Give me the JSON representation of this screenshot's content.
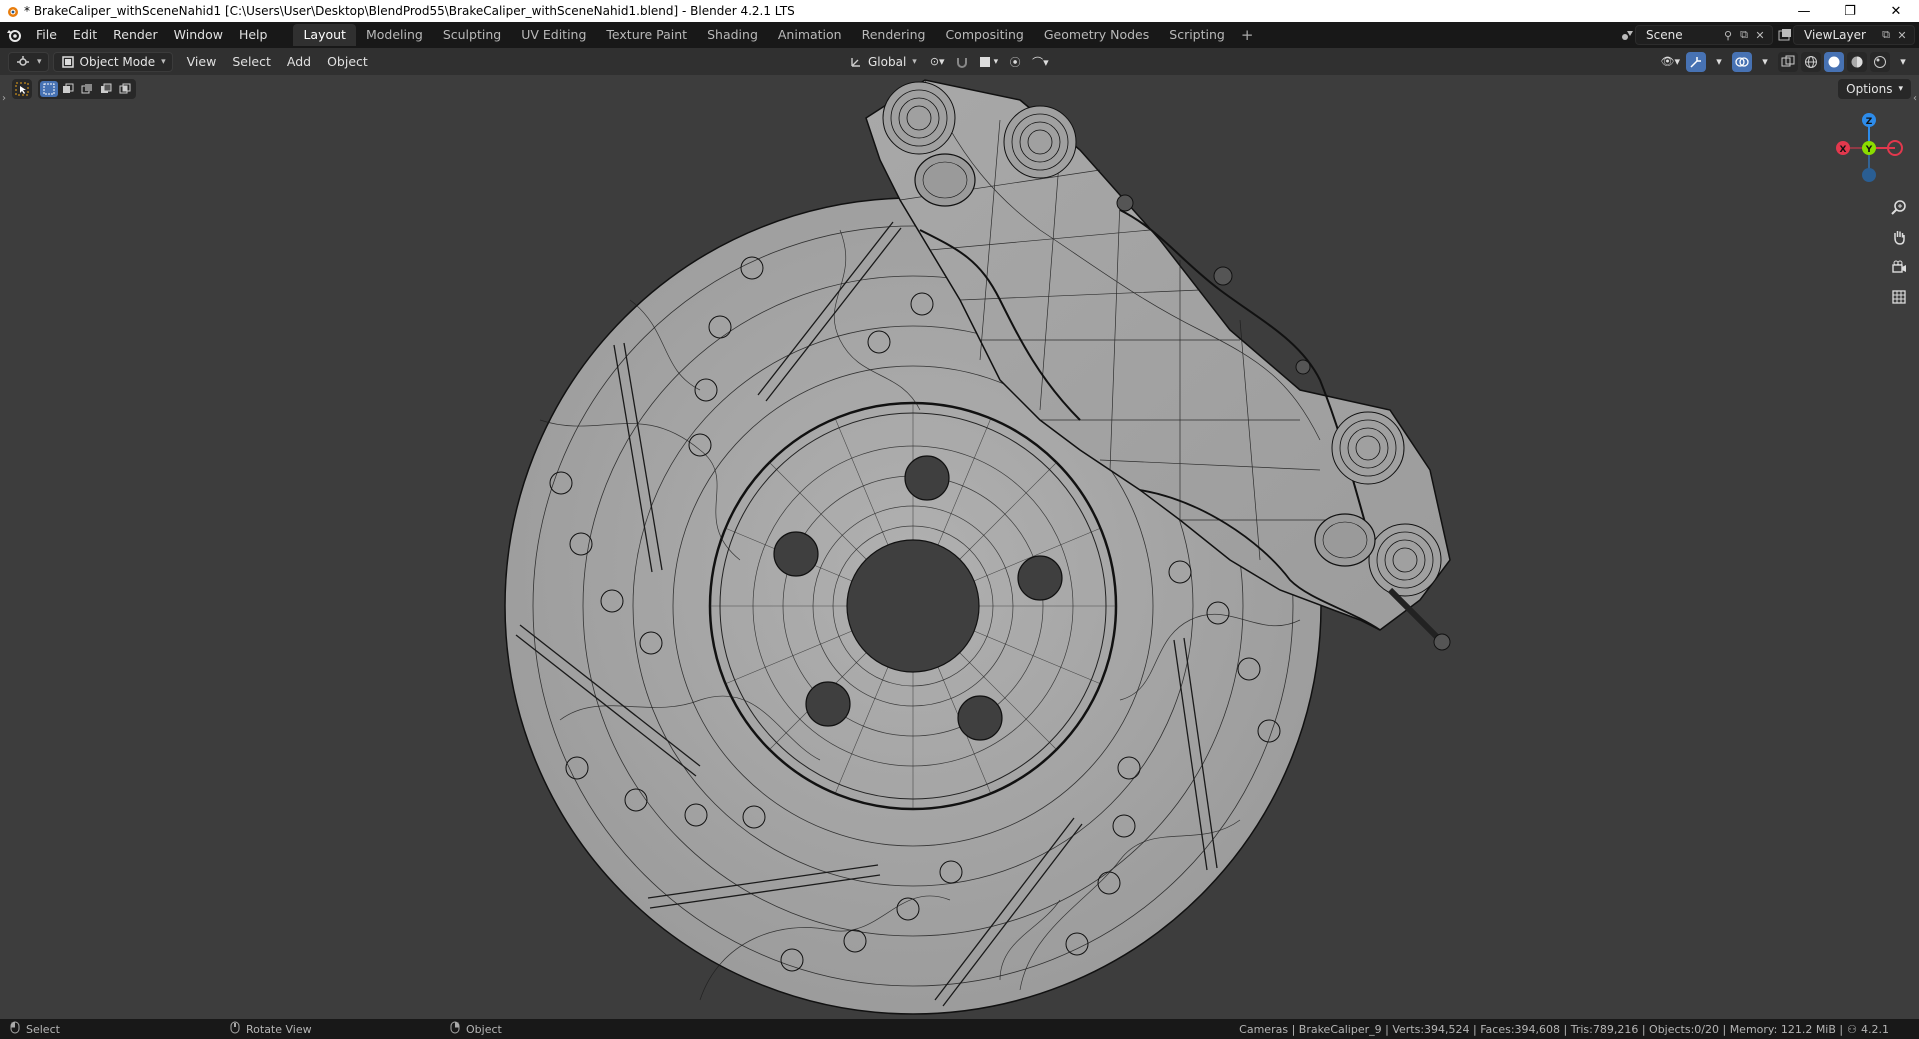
{
  "window": {
    "title": "* BrakeCaliper_withSceneNahid1 [C:\\Users\\User\\Desktop\\BlendProd55\\BrakeCaliper_withSceneNahid1.blend] - Blender 4.2.1 LTS",
    "minimize": "—",
    "maximize": "❐",
    "close": "✕"
  },
  "menu": {
    "items": [
      "File",
      "Edit",
      "Render",
      "Window",
      "Help"
    ]
  },
  "workspaces": {
    "tabs": [
      "Layout",
      "Modeling",
      "Sculpting",
      "UV Editing",
      "Texture Paint",
      "Shading",
      "Animation",
      "Rendering",
      "Compositing",
      "Geometry Nodes",
      "Scripting"
    ],
    "active": "Layout",
    "add": "+"
  },
  "scene": {
    "name": "Scene",
    "view_layer": "ViewLayer"
  },
  "header": {
    "mode": "Object Mode",
    "menus": [
      "View",
      "Select",
      "Add",
      "Object"
    ],
    "orientation": "Global"
  },
  "viewport": {
    "options_label": "Options",
    "gizmo": {
      "z": "Z",
      "y": "Y",
      "x": "X"
    },
    "colors": {
      "x_axis": "#e2384d",
      "y_axis": "#8bdc00",
      "z_axis": "#2d8ceb",
      "mesh_fill": "#a6a6a6",
      "wire": "#1a1a1a"
    }
  },
  "statusbar": {
    "left": [
      {
        "label": "Select"
      },
      {
        "label": "Rotate View"
      },
      {
        "label": "Object"
      }
    ],
    "stats": "Cameras | BrakeCaliper_9 | Verts:394,524 | Faces:394,608 | Tris:789,216 | Objects:0/20 | Memory: 121.2 MiB |",
    "version": "4.2.1"
  }
}
